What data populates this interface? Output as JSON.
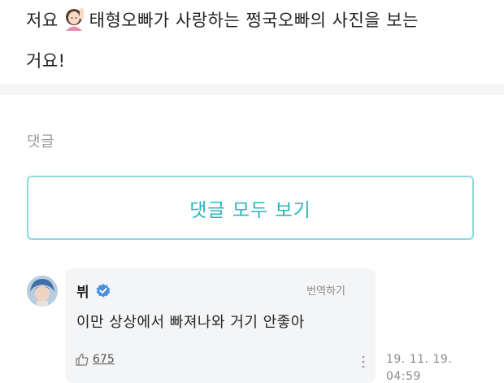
{
  "post": {
    "line1_before_emoji": "저요",
    "line1_after_emoji": "태형오빠가 사랑하는 쩡국오빠의 사진을 보는",
    "line2": "거요!",
    "emoji_name": "raising-hand-emoji"
  },
  "comments": {
    "heading": "댓글",
    "view_all_label": "댓글 모두 보기"
  },
  "comment": {
    "author": "뷔",
    "translate_label": "번역하기",
    "text": "이만 상상에서 빠져나와 거기 안좋아",
    "likes": "675",
    "date": "19. 11. 19.",
    "time": "04:59"
  },
  "colors": {
    "accent": "#2ab5bd",
    "accent_border": "#8fd8dc",
    "bubble_bg": "#f4f5f7",
    "verified": "#4a90e2"
  }
}
